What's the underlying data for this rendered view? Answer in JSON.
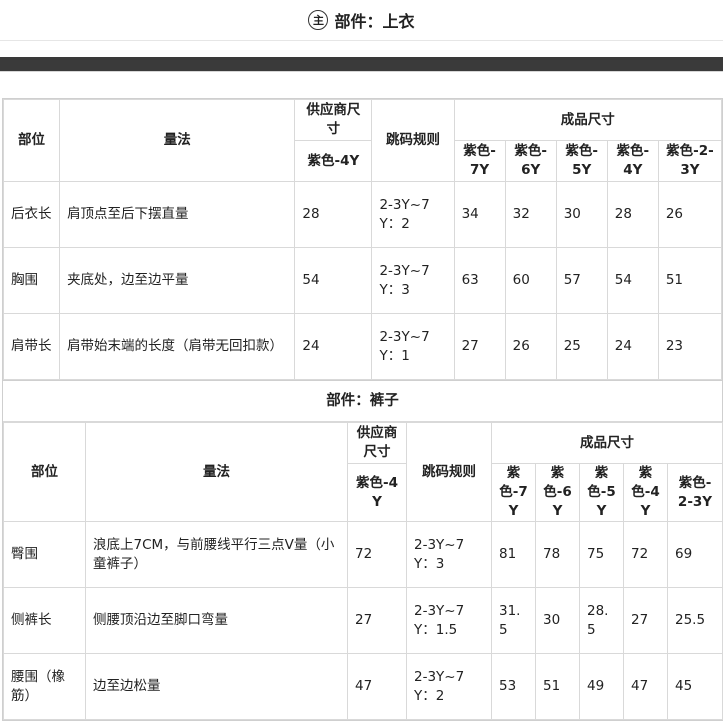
{
  "header": {
    "badge": "主",
    "title": "部件：上衣"
  },
  "table1": {
    "head": {
      "part": "部位",
      "method": "量法",
      "supplier": "供应商尺寸",
      "supplier_size": "紫色-4Y",
      "rule": "跳码规则",
      "finished": "成品尺寸",
      "sizes": [
        "紫色-7Y",
        "紫色-6Y",
        "紫色-5Y",
        "紫色-4Y",
        "紫色-2-3Y"
      ]
    },
    "rows": [
      {
        "part": "后衣长",
        "method": "肩顶点至后下摆直量",
        "supplier": "28",
        "rule": "2-3Y~7Y：2",
        "values": [
          "34",
          "32",
          "30",
          "28",
          "26"
        ]
      },
      {
        "part": "胸围",
        "method": "夹底处，边至边平量",
        "supplier": "54",
        "rule": "2-3Y~7Y：3",
        "values": [
          "63",
          "60",
          "57",
          "54",
          "51"
        ]
      },
      {
        "part": "肩带长",
        "method": "肩带始末端的长度（肩带无回扣款）",
        "supplier": "24",
        "rule": "2-3Y~7Y：1",
        "values": [
          "27",
          "26",
          "25",
          "24",
          "23"
        ]
      }
    ]
  },
  "section2_title": "部件：裤子",
  "table2": {
    "head": {
      "part": "部位",
      "method": "量法",
      "supplier": "供应商尺寸",
      "supplier_size": "紫色-4Y",
      "rule": "跳码规则",
      "finished": "成品尺寸",
      "sizes": [
        "紫色-7Y",
        "紫色-6Y",
        "紫色-5Y",
        "紫色-4Y",
        "紫色-2-3Y"
      ]
    },
    "rows": [
      {
        "part": "臀围",
        "method": "浪底上7CM，与前腰线平行三点V量（小童裤子）",
        "supplier": "72",
        "rule": "2-3Y~7Y：3",
        "values": [
          "81",
          "78",
          "75",
          "72",
          "69"
        ]
      },
      {
        "part": "侧裤长",
        "method": "侧腰顶沿边至脚口弯量",
        "supplier": "27",
        "rule": "2-3Y~7Y：1.5",
        "values": [
          "31.5",
          "30",
          "28.5",
          "27",
          "25.5"
        ]
      },
      {
        "part": "腰围（橡筋）",
        "method": "边至边松量",
        "supplier": "47",
        "rule": "2-3Y~7Y：2",
        "values": [
          "53",
          "51",
          "49",
          "47",
          "45"
        ]
      }
    ]
  }
}
